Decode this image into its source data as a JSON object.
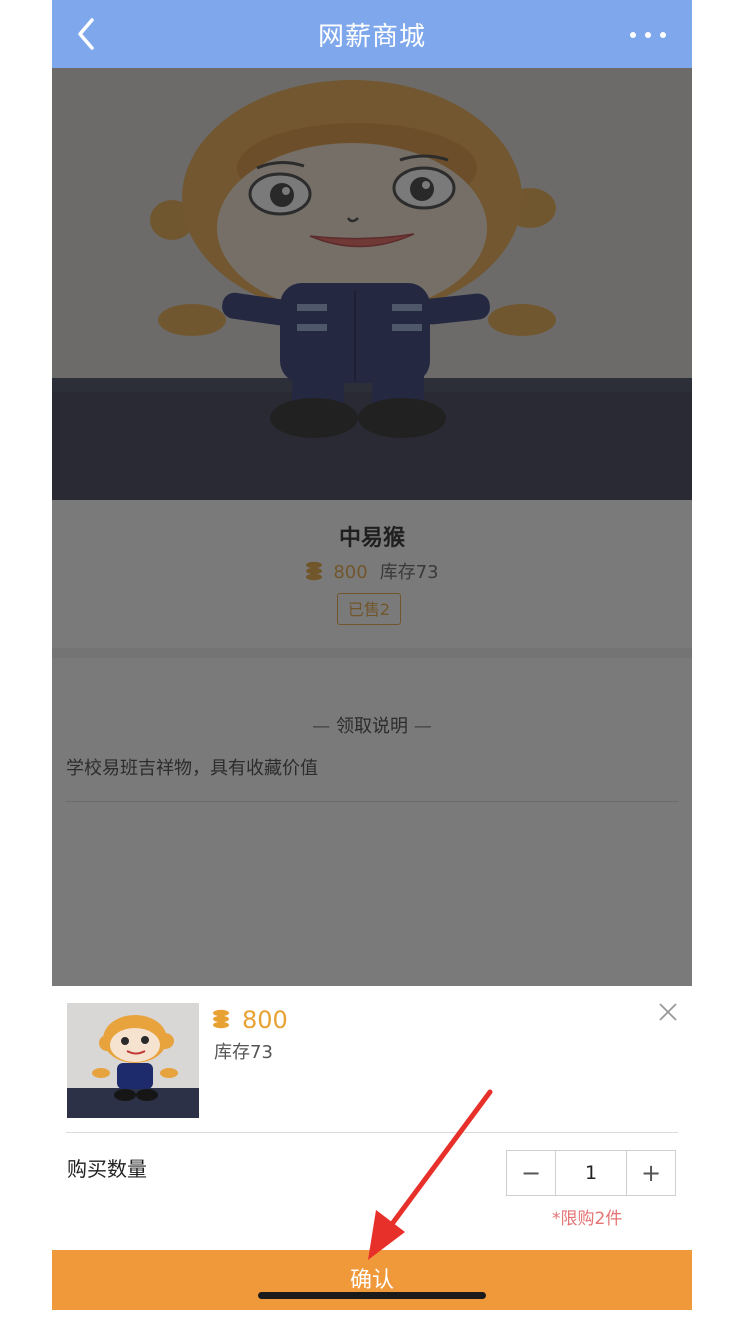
{
  "header": {
    "title": "网薪商城"
  },
  "product": {
    "name": "中易猴",
    "price": "800",
    "stock": "库存73",
    "sold": "已售2"
  },
  "description": {
    "title": "领取说明",
    "dash": "—",
    "text": "学校易班吉祥物，具有收藏价值"
  },
  "sheet": {
    "price": "800",
    "stock": "库存73",
    "quantity_label": "购买数量",
    "minus": "−",
    "plus": "+",
    "quantity": "1",
    "limit": "*限购2件",
    "confirm": "确认"
  },
  "colors": {
    "nav": "#7fa8ec",
    "accent": "#e8a133",
    "confirm": "#f0993b",
    "limit": "#e57373",
    "arrow": "#e8302a"
  },
  "icons": [
    "back-icon",
    "more-icon",
    "coin-icon",
    "close-icon",
    "arrow-annotation-icon"
  ]
}
